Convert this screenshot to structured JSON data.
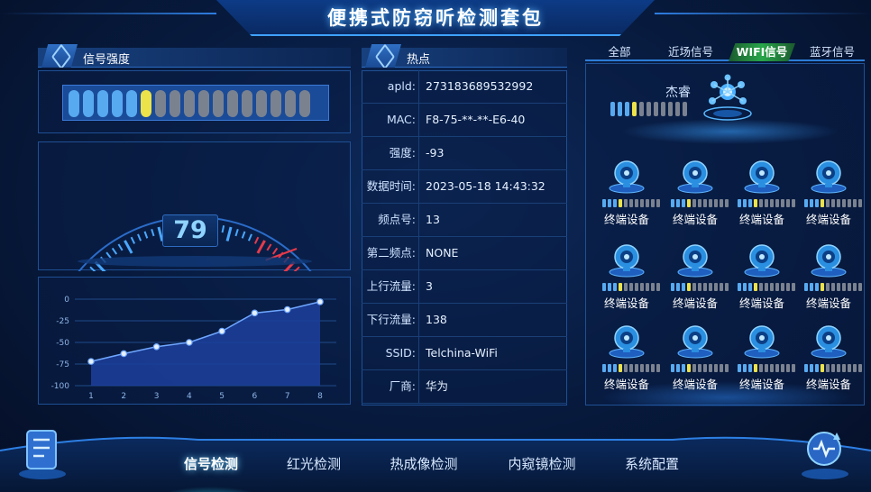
{
  "app": {
    "title": "便携式防窃听检测套包"
  },
  "signal": {
    "header": "信号强度",
    "bar_segments": 17,
    "bar_active": 5,
    "bar_peak_index": 5,
    "gauge_value": "79",
    "chart_data": {
      "type": "line",
      "x": [
        1,
        2,
        3,
        4,
        5,
        6,
        7,
        8
      ],
      "values": [
        -72,
        -63,
        -55,
        -50,
        -37,
        -16,
        -12,
        -3
      ],
      "ylim": [
        -100,
        0
      ],
      "yticks": [
        "0",
        "-25",
        "-50",
        "-75",
        "-100"
      ],
      "xticks": [
        "1",
        "2",
        "3",
        "4",
        "5",
        "6",
        "7",
        "8"
      ],
      "grid": true,
      "color": "#3a6fd8"
    }
  },
  "hotspot": {
    "header": "热点",
    "rows": [
      {
        "key": "apld:",
        "value": "273183689532992"
      },
      {
        "key": "MAC:",
        "value": "F8-75-**-**-E6-40"
      },
      {
        "key": "强度:",
        "value": "-93"
      },
      {
        "key": "数据时间:",
        "value": "2023-05-18 14:43:32"
      },
      {
        "key": "频点号:",
        "value": "13"
      },
      {
        "key": "第二频点:",
        "value": "NONE"
      },
      {
        "key": "上行流量:",
        "value": "3"
      },
      {
        "key": "下行流量:",
        "value": "138"
      },
      {
        "key": "SSID:",
        "value": "Telchina-WiFi"
      },
      {
        "key": "厂商:",
        "value": "华为"
      }
    ]
  },
  "tabs": [
    {
      "label": "全部",
      "active": false
    },
    {
      "label": "近场信号",
      "active": false
    },
    {
      "label": "WIFI信号",
      "active": true
    },
    {
      "label": "蓝牙信号",
      "active": false
    }
  ],
  "access_point": {
    "name": "杰睿",
    "bar_segments": 11,
    "bar_active": 3,
    "bar_peak_index": 3
  },
  "devices": [
    {
      "name": "终端设备"
    },
    {
      "name": "终端设备"
    },
    {
      "name": "终端设备"
    },
    {
      "name": "终端设备"
    },
    {
      "name": "终端设备"
    },
    {
      "name": "终端设备"
    },
    {
      "name": "终端设备"
    },
    {
      "name": "终端设备"
    },
    {
      "name": "终端设备"
    },
    {
      "name": "终端设备"
    },
    {
      "name": "终端设备"
    },
    {
      "name": "终端设备"
    }
  ],
  "device_bar": {
    "segments": 11,
    "active": 3,
    "peak_index": 3
  },
  "nav": [
    {
      "label": "信号检测",
      "active": true
    },
    {
      "label": "红光检测",
      "active": false
    },
    {
      "label": "热成像检测",
      "active": false
    },
    {
      "label": "内窥镜检测",
      "active": false
    },
    {
      "label": "系统配置",
      "active": false
    }
  ],
  "colors": {
    "accent": "#3fa2ff",
    "active_tab": "#28a64a",
    "bar_on": "#58aaf0",
    "bar_peak": "#ece24a",
    "bar_off": "#7a8290"
  }
}
